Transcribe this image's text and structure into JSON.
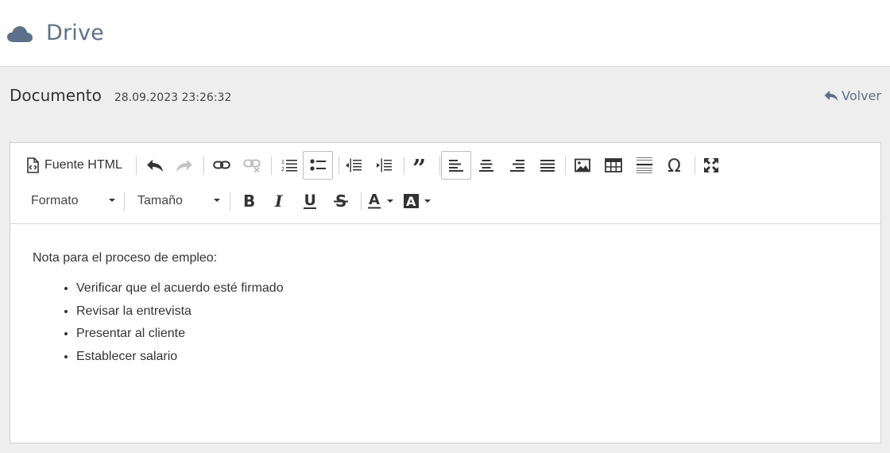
{
  "app": {
    "title": "Drive",
    "icon": "cloud-icon"
  },
  "document": {
    "title": "Documento",
    "date": "28.09.2023 23:26:32"
  },
  "back": {
    "label": "Volver",
    "icon": "reply-arrow-icon"
  },
  "toolbar": {
    "html_source_label": "Fuente HTML",
    "format_label": "Formato",
    "size_label": "Tamaño",
    "row1_icons": [
      "undo-icon",
      "redo-icon",
      "link-icon",
      "unlink-icon",
      "numbered-list-icon",
      "bulleted-list-icon",
      "outdent-icon",
      "indent-icon",
      "blockquote-icon",
      "align-left-icon",
      "align-center-icon",
      "align-right-icon",
      "align-justify-icon",
      "image-icon",
      "table-icon",
      "horizontal-line-icon",
      "special-character-icon",
      "maximize-icon"
    ],
    "row2_icons": [
      "bold-icon",
      "italic-icon",
      "underline-icon",
      "strikethrough-icon",
      "text-color-icon",
      "background-color-icon"
    ],
    "active_buttons": [
      "bulleted-list",
      "align-left"
    ]
  },
  "content": {
    "intro": "Nota para el proceso de empleo:",
    "items": [
      "Verificar que el acuerdo esté firmado",
      "Revisar la entrevista",
      "Presentar al cliente",
      "Establecer salario"
    ]
  },
  "colors": {
    "accent": "#5b7189",
    "background": "#eeeeee",
    "text": "#333333"
  }
}
